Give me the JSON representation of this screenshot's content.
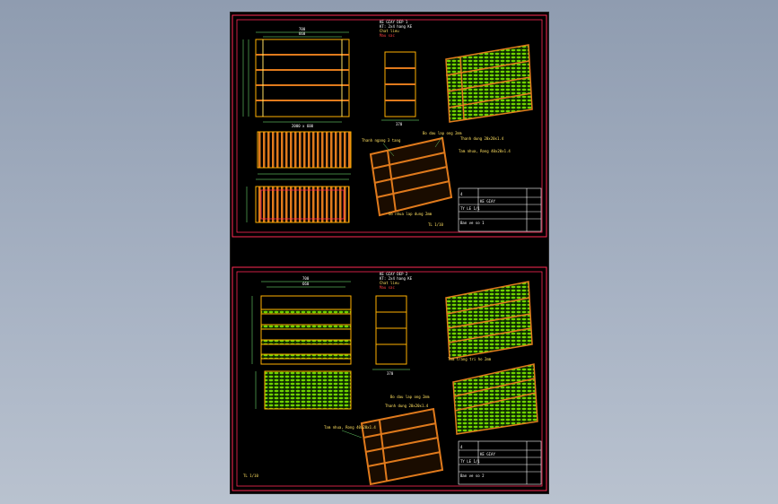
{
  "sheets": [
    {
      "id": "top",
      "notes": [
        "KE GIAY DEP 1",
        "KT: 2x4 hang KE",
        "Chat lieu",
        "Mau sac"
      ],
      "front_dims": {
        "width": "700",
        "inner": "660",
        "bottom": "2000 x 600"
      },
      "side_dims": {
        "width": "370"
      },
      "callouts": [
        "Thanh ngang 3 tang",
        "Bo dau lap ong 2mm",
        "Thanh dung 20x20x1.4",
        "Tam nhua, Rong 40x20x1.4",
        "Go nhua lap dung 2mm"
      ],
      "scale_label": "TL 1/10",
      "title_block": {
        "rows": [
          "KE GIAY",
          "TY LE 1/1",
          "Ban ve so 1"
        ],
        "mark": "4"
      }
    },
    {
      "id": "bottom",
      "notes": [
        "KE GIAY DEP 2",
        "KT: 2x4 hang KE",
        "Chat lieu",
        "Mau sac"
      ],
      "front_dims": {
        "width": "700",
        "inner": "660"
      },
      "side_dims": {
        "width": "370"
      },
      "callouts": [
        "Tam trang tri ho 2mm",
        "Bo dau lap ong 2mm",
        "Thanh dung 20x20x1.4",
        "Tam nhua, Rong 40x20x1.4"
      ],
      "scale_label": "TL 1/10",
      "title_block": {
        "rows": [
          "KE GIAY",
          "TY LE 1/1",
          "Ban ve so 2"
        ],
        "mark": "4"
      }
    }
  ]
}
